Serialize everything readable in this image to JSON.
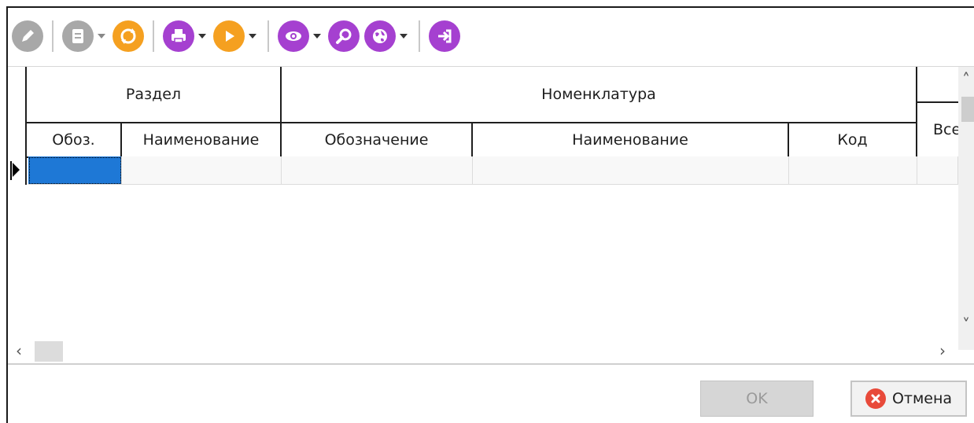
{
  "toolbar": {
    "buttons": [
      {
        "icon": "edit-icon",
        "enabled": false
      },
      {
        "icon": "document-icon",
        "enabled": false,
        "dropdown": true
      },
      {
        "icon": "refresh-icon",
        "enabled": true
      },
      {
        "icon": "print-icon",
        "enabled": true,
        "dropdown": true
      },
      {
        "icon": "play-icon",
        "enabled": true,
        "dropdown": true
      },
      {
        "icon": "view-icon",
        "enabled": true,
        "dropdown": true
      },
      {
        "icon": "search-icon",
        "enabled": true
      },
      {
        "icon": "globe-icon",
        "enabled": true,
        "dropdown": true
      },
      {
        "icon": "exit-icon",
        "enabled": true
      }
    ]
  },
  "grid": {
    "group_headers": {
      "section": "Раздел",
      "nomenclature": "Номенклатура",
      "all_partial": "Все"
    },
    "columns": {
      "section_code": "Обоз.",
      "section_name": "Наименование",
      "nom_code": "Обозначение",
      "nom_name": "Наименование",
      "code": "Код"
    },
    "rows": [
      [
        "",
        "",
        "",
        "",
        "",
        ""
      ]
    ]
  },
  "buttons": {
    "ok": "OK",
    "cancel": "Отмена"
  },
  "colors": {
    "selection": "#1e78d6",
    "orange": "#f5a020",
    "purple": "#a540d0",
    "disabled": "#9e9e9e",
    "cancel": "#e84a3a"
  }
}
